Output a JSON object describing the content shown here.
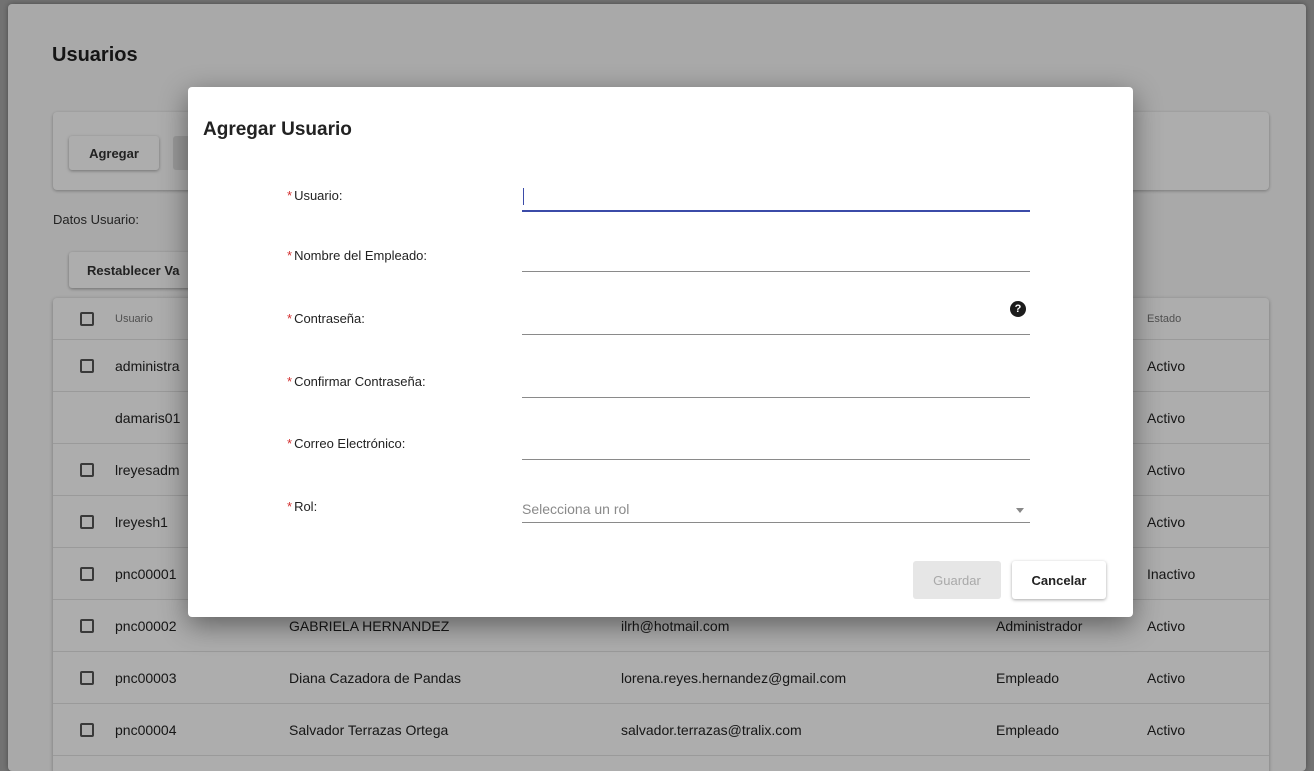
{
  "page": {
    "title": "Usuarios",
    "toolbar": {
      "add_label": "Agregar"
    },
    "datos_label": "Datos Usuario:",
    "reset_label": "Restablecer Va"
  },
  "table": {
    "headers": {
      "user": "Usuario",
      "estado": "Estado"
    },
    "rows": [
      {
        "user": "administra",
        "name": "",
        "email": "",
        "rol": "",
        "estado": "Activo",
        "checkbox": true
      },
      {
        "user": "damaris01",
        "name": "",
        "email": "",
        "rol": "",
        "estado": "Activo",
        "checkbox": false
      },
      {
        "user": "lreyesadm",
        "name": "",
        "email": "",
        "rol": "",
        "estado": "Activo",
        "checkbox": true
      },
      {
        "user": "lreyesh1",
        "name": "",
        "email": "",
        "rol": "",
        "estado": "Activo",
        "checkbox": true
      },
      {
        "user": "pnc00001",
        "name": "",
        "email": "",
        "rol": "",
        "estado": "Inactivo",
        "checkbox": true
      },
      {
        "user": "pnc00002",
        "name": "GABRIELA HERNANDEZ",
        "email": "ilrh@hotmail.com",
        "rol": "Administrador",
        "estado": "Activo",
        "checkbox": true
      },
      {
        "user": "pnc00003",
        "name": "Diana Cazadora de Pandas",
        "email": "lorena.reyes.hernandez@gmail.com",
        "rol": "Empleado",
        "estado": "Activo",
        "checkbox": true
      },
      {
        "user": "pnc00004",
        "name": "Salvador Terrazas Ortega",
        "email": "salvador.terrazas@tralix.com",
        "rol": "Empleado",
        "estado": "Activo",
        "checkbox": true
      }
    ]
  },
  "dialog": {
    "title": "Agregar Usuario",
    "required_mark": "*",
    "fields": {
      "usuario": {
        "label": "Usuario:",
        "value": ""
      },
      "nombre": {
        "label": "Nombre del Empleado:",
        "value": ""
      },
      "password": {
        "label": "Contraseña:",
        "value": "",
        "help_icon": "question-circle-icon",
        "help_glyph": "?"
      },
      "confirm": {
        "label": "Confirmar Contraseña:",
        "value": ""
      },
      "correo": {
        "label": "Correo Electrónico:",
        "value": ""
      },
      "rol": {
        "label": "Rol:",
        "placeholder": "Selecciona un rol"
      }
    },
    "save_label": "Guardar",
    "cancel_label": "Cancelar"
  },
  "colors": {
    "accent": "#3b4ba8",
    "required": "#d32f2f",
    "disabled_bg": "#e6e6e6",
    "disabled_text": "#a9a9a9"
  }
}
